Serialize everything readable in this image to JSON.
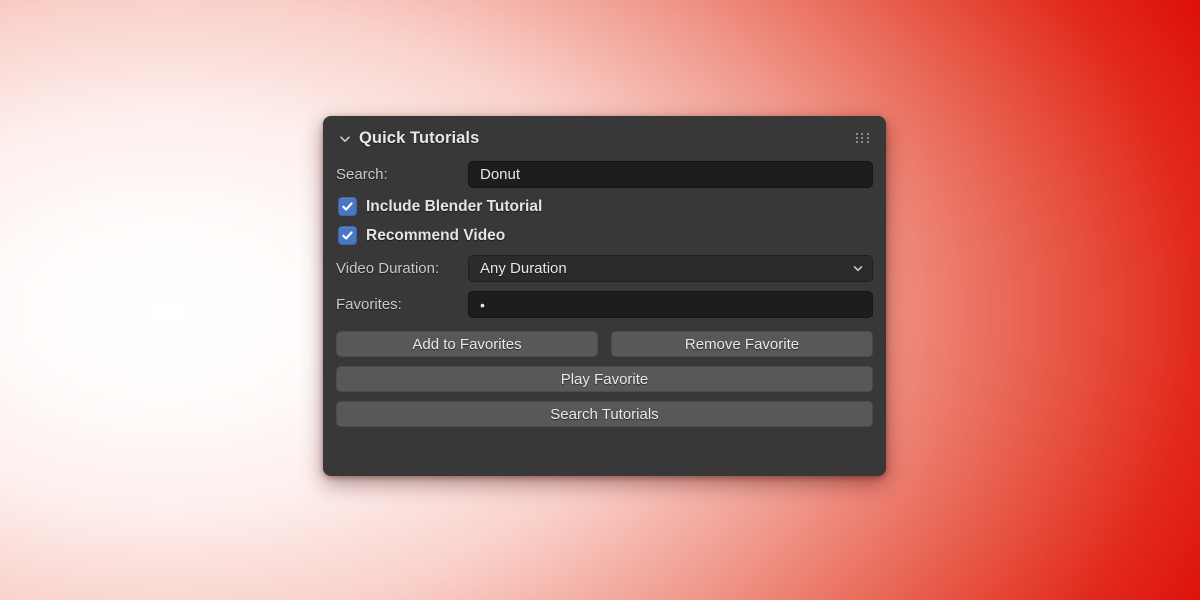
{
  "panel": {
    "title": "Quick Tutorials",
    "collapse_icon": "chevron-down-icon",
    "grip_icon": "drag-grip-icon",
    "accent_blue": "#4a77c2",
    "panel_bg": "#383838",
    "button_bg": "#585858",
    "input_bg": "#1d1d1d"
  },
  "fields": {
    "search_label": "Search:",
    "search_value": "Donut",
    "search_placeholder": "",
    "include_blender_label": "Include Blender Tutorial",
    "include_blender_checked": true,
    "recommend_video_label": "Recommend Video",
    "recommend_video_checked": true,
    "video_duration_label": "Video Duration:",
    "video_duration_value": "Any Duration",
    "video_duration_options": [
      "Any Duration"
    ],
    "favorites_label": "Favorites:",
    "favorites_value": "•"
  },
  "buttons": {
    "add_to_favorites": "Add to Favorites",
    "remove_favorite": "Remove Favorite",
    "play_favorite": "Play Favorite",
    "search_tutorials": "Search Tutorials"
  },
  "background": {
    "from": "#ffffff",
    "to": "#dd1008"
  }
}
